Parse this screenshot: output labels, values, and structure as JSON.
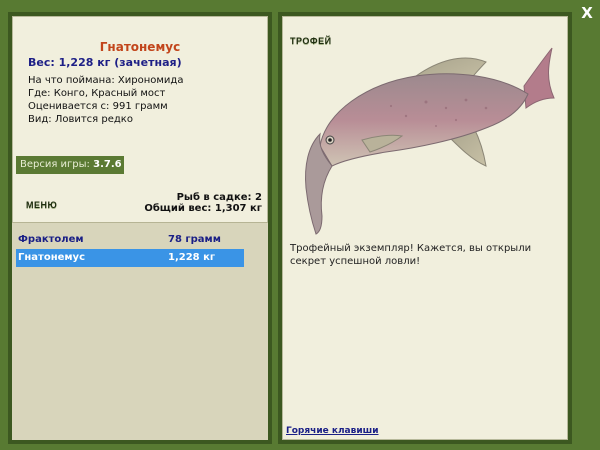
{
  "window": {
    "close_label": "X"
  },
  "fish": {
    "name": "Гнатонемус",
    "weight_line": "Вес: 1,228 кг (зачетная)",
    "info_lines": [
      "На что поймана: Хирономида",
      "Где: Конго, Красный мост",
      "Оценивается с: 991 грамм",
      "Вид: Ловится редко"
    ]
  },
  "version": {
    "label": "Версия игры:",
    "value": "3.7.6"
  },
  "menu": {
    "label": "МЕНЮ"
  },
  "keep": {
    "count_line": "Рыб в садке: 2",
    "weight_line": "Общий вес: 1,307 кг"
  },
  "catch_list": [
    {
      "name": "Фрактолем",
      "amount": "78 грамм",
      "selected": false
    },
    {
      "name": "Гнатонемус",
      "amount": "1,228 кг",
      "selected": true
    }
  ],
  "trophy": {
    "label": "ТРОФЕЙ",
    "text": "Трофейный экземпляр! Кажется, вы открыли секрет успешной ловли!"
  },
  "hotkeys": {
    "label": "Горячие клавиши"
  },
  "colors": {
    "frame_green": "#587a32",
    "panel_bg": "#f1efdd",
    "title_orange": "#c2451b",
    "text_navy": "#1d1f86",
    "selection_blue": "#3a94e6"
  }
}
